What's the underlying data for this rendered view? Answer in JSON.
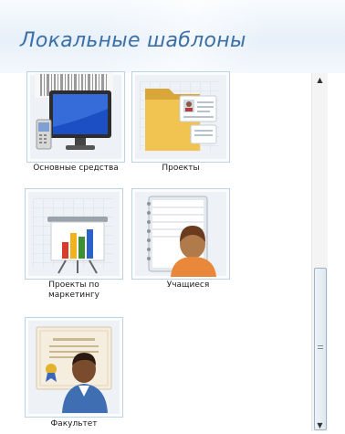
{
  "header": {
    "title": "Локальные шаблоны"
  },
  "templates": [
    {
      "label": "Основные средства",
      "icon": "computer-icon"
    },
    {
      "label": "Проекты",
      "icon": "folder-icon"
    },
    {
      "label": "Проекты по маркетингу",
      "icon": "chart-presentation-icon"
    },
    {
      "label": "Учащиеся",
      "icon": "student-icon"
    },
    {
      "label": "Факультет",
      "icon": "teacher-icon"
    }
  ],
  "scrollbar": {
    "up_icon": "scroll-up-arrow-icon",
    "down_icon": "scroll-down-arrow-icon"
  }
}
